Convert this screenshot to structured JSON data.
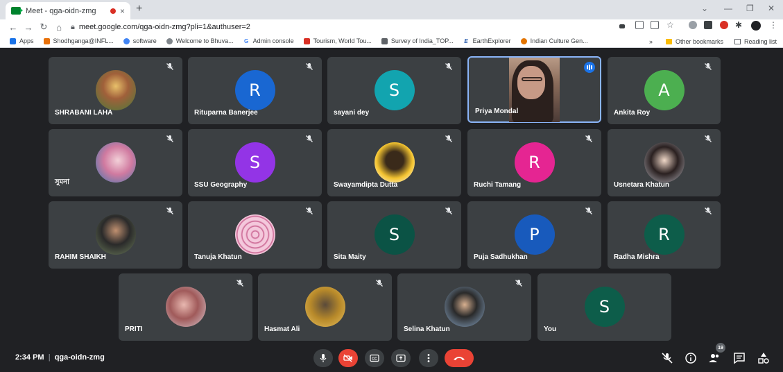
{
  "browser": {
    "tab_title": "Meet - qga-oidn-zmg",
    "tab_close": "×",
    "new_tab": "+",
    "url": "meet.google.com/qga-oidn-zmg?pli=1&authuser=2",
    "win_min": "—",
    "win_restore": "❐",
    "win_close": "✕",
    "chevron": "⌄"
  },
  "bookmarks": {
    "items": [
      {
        "label": "Apps",
        "icon": "apps-icon",
        "color": "#1a73e8"
      },
      {
        "label": "Shodhganga@INFL...",
        "icon": "shodhganga-icon",
        "color": "#e8710a"
      },
      {
        "label": "software",
        "icon": "bird-icon",
        "color": "#4285f4"
      },
      {
        "label": "Welcome to Bhuva...",
        "icon": "bhuvan-icon",
        "color": "#80868b"
      },
      {
        "label": "Admin console",
        "icon": "google-icon",
        "color": "#4285f4"
      },
      {
        "label": "Tourism, World Tou...",
        "icon": "tourism-icon",
        "color": "#d93025"
      },
      {
        "label": "Survey of India_TOP...",
        "icon": "survey-icon",
        "color": "#5f6368"
      },
      {
        "label": "EarthExplorer",
        "icon": "ee-icon",
        "color": "#174ea6"
      },
      {
        "label": "Indian Culture Gen...",
        "icon": "culture-icon",
        "color": "#e37400"
      }
    ],
    "more": "»",
    "other": "Other bookmarks",
    "reading": "Reading list"
  },
  "participants": [
    {
      "name": "SHRABANI LAHA",
      "avatar": "photo",
      "color": "#7a9a4a",
      "muted": true
    },
    {
      "name": "Rituparna Banerjee",
      "letter": "R",
      "color": "#1967d2",
      "muted": true
    },
    {
      "name": "sayani dey",
      "letter": "S",
      "color": "#12a4af",
      "muted": true
    },
    {
      "name": "Priya Mondal",
      "video": true,
      "speaking": true
    },
    {
      "name": "Ankita Roy",
      "letter": "A",
      "color": "#4caf50",
      "muted": true
    },
    {
      "name": "সুমনা",
      "avatar": "photo",
      "color": "#d07aa0",
      "muted": true
    },
    {
      "name": "SSU Geography",
      "letter": "S",
      "color": "#9334e6",
      "muted": true
    },
    {
      "name": "Swayamdipta Dutta",
      "avatar": "photo",
      "color": "#f4c430",
      "muted": true
    },
    {
      "name": "Ruchi Tamang",
      "letter": "R",
      "color": "#e52592",
      "muted": true
    },
    {
      "name": "Usnetara Khatun",
      "avatar": "photo",
      "color": "#b0b0b8",
      "muted": true
    },
    {
      "name": "RAHIM SHAIKH",
      "avatar": "photo",
      "color": "#6a7a5a",
      "muted": true
    },
    {
      "name": "Tanuja Khatun",
      "avatar": "photo",
      "color": "#e8a6c8",
      "muted": true
    },
    {
      "name": "Sita Maity",
      "letter": "S",
      "color": "#0b5345",
      "muted": true
    },
    {
      "name": "Puja Sadhukhan",
      "letter": "P",
      "color": "#185abc",
      "muted": true
    },
    {
      "name": "Radha Mishra",
      "letter": "R",
      "color": "#0d5d4a",
      "muted": true
    },
    {
      "name": "PRITI",
      "avatar": "photo",
      "color": "#a05a5a",
      "muted": true
    },
    {
      "name": "Hasmat Ali",
      "avatar": "photo",
      "color": "#b88a2a",
      "muted": true
    },
    {
      "name": "Selina Khatun",
      "avatar": "photo",
      "color": "#6a8aaa",
      "muted": true
    },
    {
      "name": "You",
      "letter": "S",
      "color": "#0d5d4a",
      "muted": false
    }
  ],
  "bottom": {
    "time": "2:34 PM",
    "separator": "|",
    "meeting_code": "qga-oidn-zmg",
    "people_count": "19"
  }
}
